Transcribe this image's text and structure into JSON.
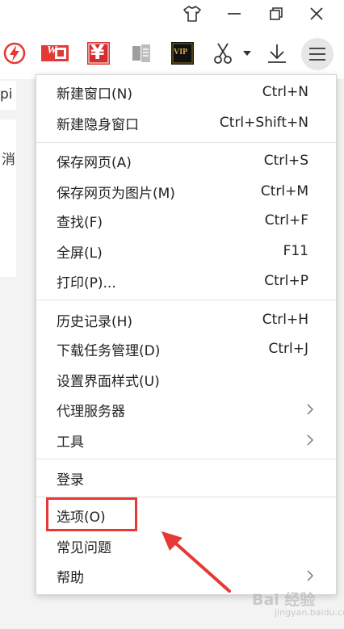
{
  "window": {
    "skin_icon": "tshirt-icon",
    "minimize_icon": "minimize-icon",
    "restore_icon": "restore-icon",
    "close_icon": "close-icon"
  },
  "toolbar": {
    "icons": [
      "lightning-icon",
      "wps-icon",
      "yen-icon",
      "document-icon",
      "vip-icon",
      "scissors-icon",
      "dropdown-icon",
      "download-icon",
      "menu-icon"
    ],
    "wps_label": "W",
    "yen_label": "¥",
    "vip_label": "VIP"
  },
  "background": {
    "fragment_1": "pi",
    "fragment_2": "消"
  },
  "menu": {
    "groups": [
      [
        {
          "label": "新建窗口(N)",
          "shortcut": "Ctrl+N"
        },
        {
          "label": "新建隐身窗口",
          "shortcut": "Ctrl+Shift+N"
        }
      ],
      [
        {
          "label": "保存网页(A)",
          "shortcut": "Ctrl+S"
        },
        {
          "label": "保存网页为图片(M)",
          "shortcut": "Ctrl+M"
        },
        {
          "label": "查找(F)",
          "shortcut": "Ctrl+F"
        },
        {
          "label": "全屏(L)",
          "shortcut": "F11"
        },
        {
          "label": "打印(P)...",
          "shortcut": "Ctrl+P"
        }
      ],
      [
        {
          "label": "历史记录(H)",
          "shortcut": "Ctrl+H"
        },
        {
          "label": "下载任务管理(D)",
          "shortcut": "Ctrl+J"
        },
        {
          "label": "设置界面样式(U)",
          "shortcut": ""
        },
        {
          "label": "代理服务器",
          "shortcut": "",
          "submenu": true
        },
        {
          "label": "工具",
          "shortcut": "",
          "submenu": true
        }
      ],
      [
        {
          "label": "登录",
          "shortcut": ""
        }
      ],
      [
        {
          "label": "选项(O)",
          "shortcut": ""
        },
        {
          "label": "常见问题",
          "shortcut": ""
        },
        {
          "label": "帮助",
          "shortcut": "",
          "submenu": true
        }
      ]
    ]
  },
  "annotation": {
    "highlight_color": "#e53935"
  },
  "watermark": {
    "text": "Bai 经验",
    "sub": "jingyan.baidu.com"
  }
}
